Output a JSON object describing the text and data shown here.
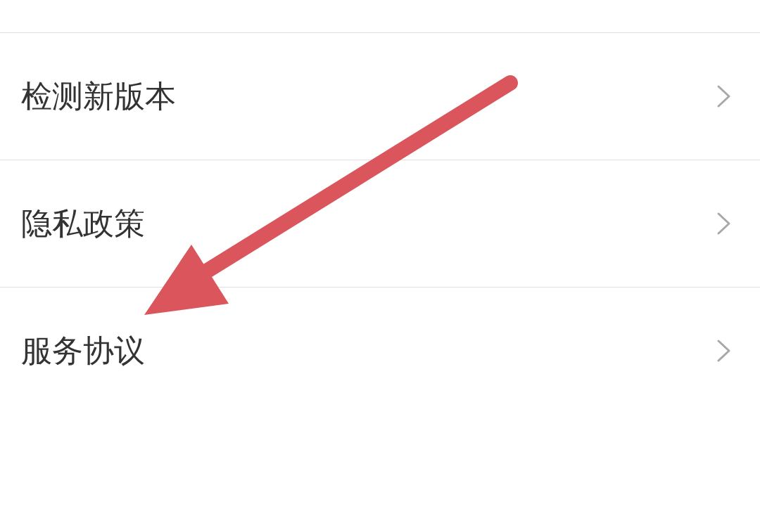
{
  "settings_items": [
    {
      "label": "检测新版本"
    },
    {
      "label": "隐私政策"
    },
    {
      "label": "服务协议"
    }
  ],
  "annotation": {
    "kind": "arrow"
  }
}
